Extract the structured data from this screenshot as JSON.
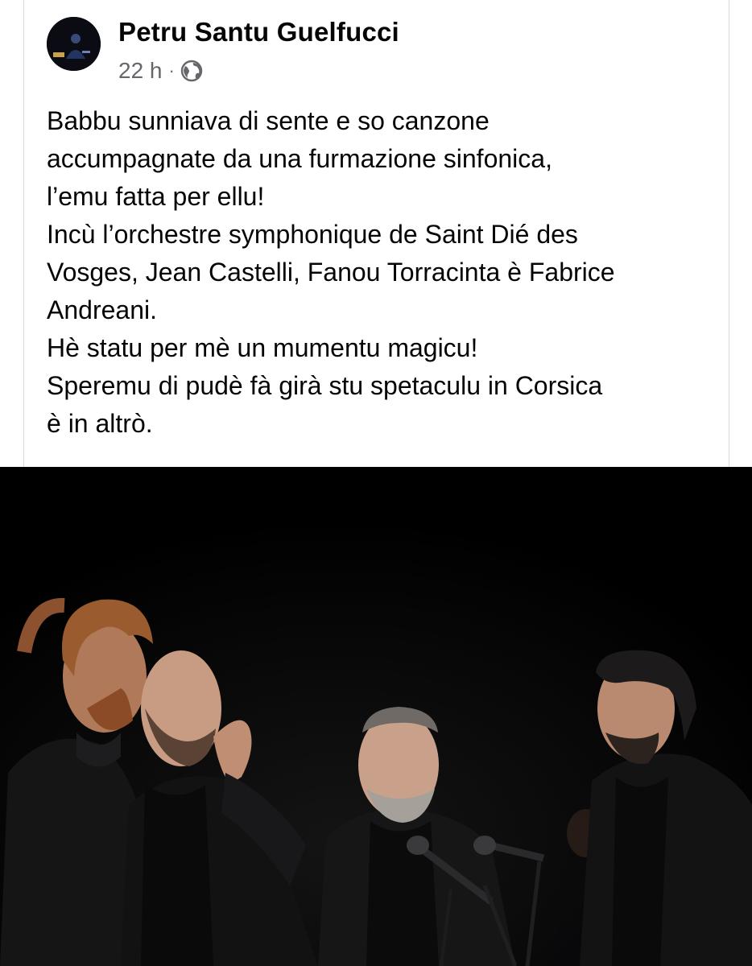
{
  "post": {
    "author": "Petru Santu Guelfucci",
    "timestamp": "22 h",
    "separator": "·",
    "privacy_icon": "globe-icon",
    "text_lines": [
      "Babbu sunniava di sente e so canzone",
      "accumpagnate da una furmazione sinfonica,",
      "l’emu fatta per ellu!",
      "Incù l’orchestre symphonique de Saint Dié des",
      "Vosges, Jean Castelli, Fanou Torracinta è Fabrice",
      "Andreani.",
      "Hè statu per mè un mumentu magicu!",
      "Speremu di pudè fà girà stu spetaculu in Corsica",
      "è in altrò."
    ]
  },
  "colors": {
    "text_primary": "#050505",
    "text_secondary": "#65676b",
    "divider": "#d8dadf",
    "photo_background": "#010101"
  }
}
